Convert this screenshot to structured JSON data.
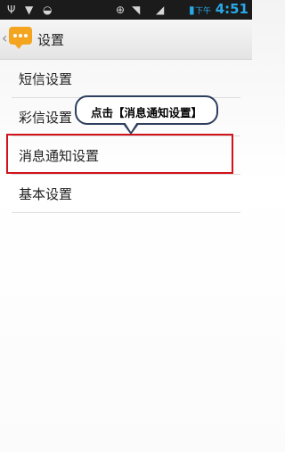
{
  "status_bar": {
    "time": "4:51",
    "ampm": "下午",
    "icons": [
      "usb-icon",
      "shield-icon",
      "game-controller-icon",
      "sync-icon",
      "wifi-icon",
      "signal-icon",
      "battery-icon"
    ]
  },
  "app_bar": {
    "title": "设置",
    "icon": "message-bubble-icon"
  },
  "settings": {
    "items": [
      {
        "label": "短信设置"
      },
      {
        "label": "彩信设置"
      },
      {
        "label": "消息通知设置"
      },
      {
        "label": "基本设置"
      }
    ]
  },
  "annotation": {
    "callout_text": "点击【消息通知设置】",
    "highlight_color": "#d2131c",
    "callout_border_color": "#2d3e5f"
  },
  "colors": {
    "status_time": "#28a9e6",
    "app_icon": "#f3a51f"
  }
}
